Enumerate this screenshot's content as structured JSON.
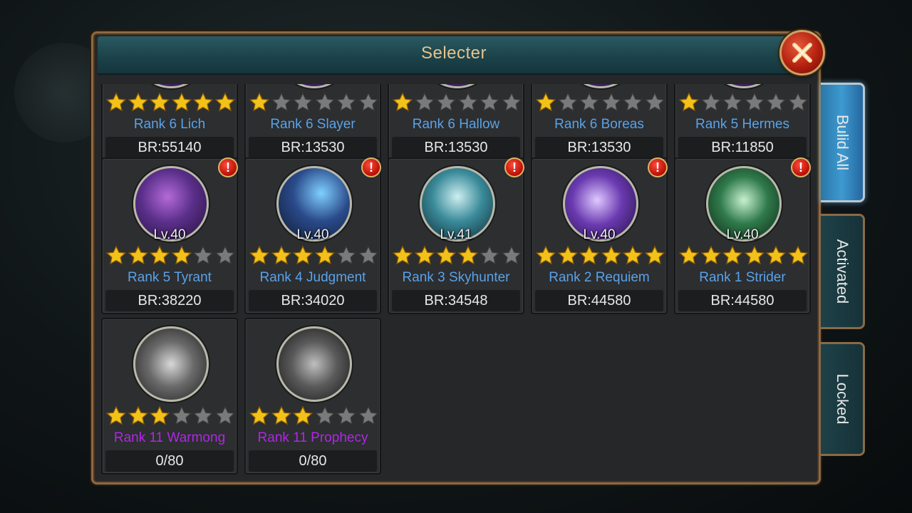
{
  "dialog": {
    "title": "Selecter"
  },
  "tabs": [
    {
      "label": "Bulid All",
      "active": true
    },
    {
      "label": "Activated",
      "active": false
    },
    {
      "label": "Locked",
      "active": false
    }
  ],
  "cards": [
    {
      "level": "",
      "stars": 6,
      "name": "Rank 6 Lich",
      "value": "BR:55140",
      "alert": false,
      "name_color": "blue"
    },
    {
      "level": "",
      "stars": 1,
      "name": "Rank 6 Slayer",
      "value": "BR:13530",
      "alert": false,
      "name_color": "blue"
    },
    {
      "level": "",
      "stars": 1,
      "name": "Rank 6 Hallow",
      "value": "BR:13530",
      "alert": false,
      "name_color": "blue"
    },
    {
      "level": "",
      "stars": 1,
      "name": "Rank 6 Boreas",
      "value": "BR:13530",
      "alert": false,
      "name_color": "blue"
    },
    {
      "level": "",
      "stars": 1,
      "name": "Rank 5 Hermes",
      "value": "BR:11850",
      "alert": false,
      "name_color": "blue"
    },
    {
      "level": "Lv.40",
      "stars": 4,
      "name": "Rank 5 Tyrant",
      "value": "BR:38220",
      "alert": true,
      "name_color": "blue"
    },
    {
      "level": "Lv.40",
      "stars": 4,
      "name": "Rank 4 Judgment",
      "value": "BR:34020",
      "alert": true,
      "name_color": "blue"
    },
    {
      "level": "Lv.41",
      "stars": 4,
      "name": "Rank 3 Skyhunter",
      "value": "BR:34548",
      "alert": true,
      "name_color": "blue"
    },
    {
      "level": "Lv.40",
      "stars": 6,
      "name": "Rank 2 Requiem",
      "value": "BR:44580",
      "alert": true,
      "name_color": "blue"
    },
    {
      "level": "Lv.40",
      "stars": 6,
      "name": "Rank 1 Strider",
      "value": "BR:44580",
      "alert": true,
      "name_color": "blue"
    },
    {
      "level": "",
      "stars": 3,
      "name": "Rank 11 Warmong",
      "value": "0/80",
      "alert": false,
      "name_color": "purple"
    },
    {
      "level": "",
      "stars": 3,
      "name": "Rank 11 Prophecy",
      "value": "0/80",
      "alert": false,
      "name_color": "purple"
    }
  ],
  "alert_glyph": "!",
  "colors": {
    "portraits": [
      "#5a2f8a",
      "#2a4a8a",
      "#3a8a9a",
      "#6a3ab0",
      "#2f7a4a",
      "#6a6a6a",
      "#5a5a5a"
    ]
  },
  "icons": {
    "close": "close-x-icon",
    "star_filled": "gold-star-icon",
    "star_empty": "gray-star-icon"
  }
}
